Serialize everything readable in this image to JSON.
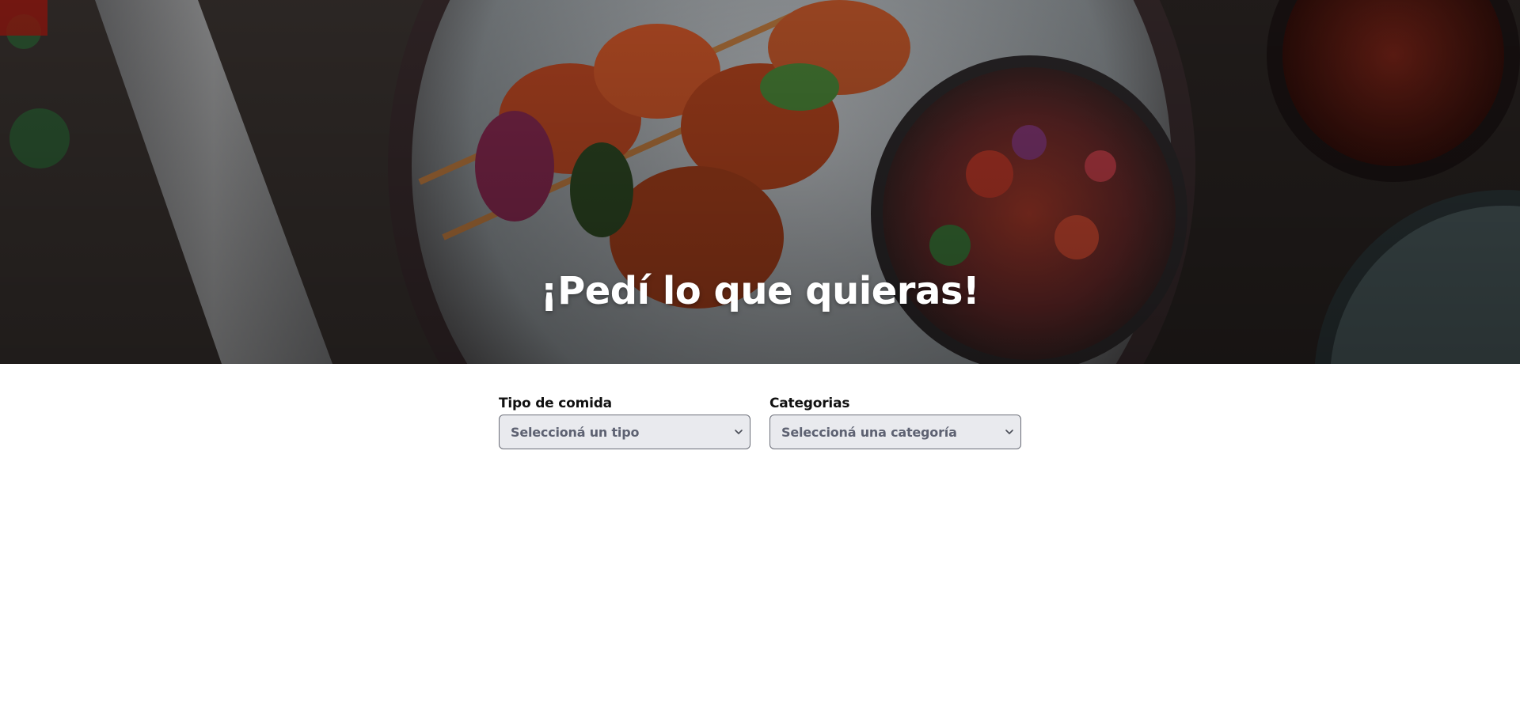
{
  "hero": {
    "title": "¡Pedí lo que quieras!"
  },
  "filters": {
    "food_type": {
      "label": "Tipo de comida",
      "selected": "Seleccioná un tipo"
    },
    "categories": {
      "label": "Categorias",
      "selected": "Seleccioná una categoría"
    }
  },
  "icons": {
    "select_indicator": "chevron-down-icon"
  },
  "colors": {
    "hero_overlay": "#1e1a18",
    "select_background": "#e9eaee",
    "select_text": "#5e6272",
    "select_border": "#6b6e78"
  }
}
